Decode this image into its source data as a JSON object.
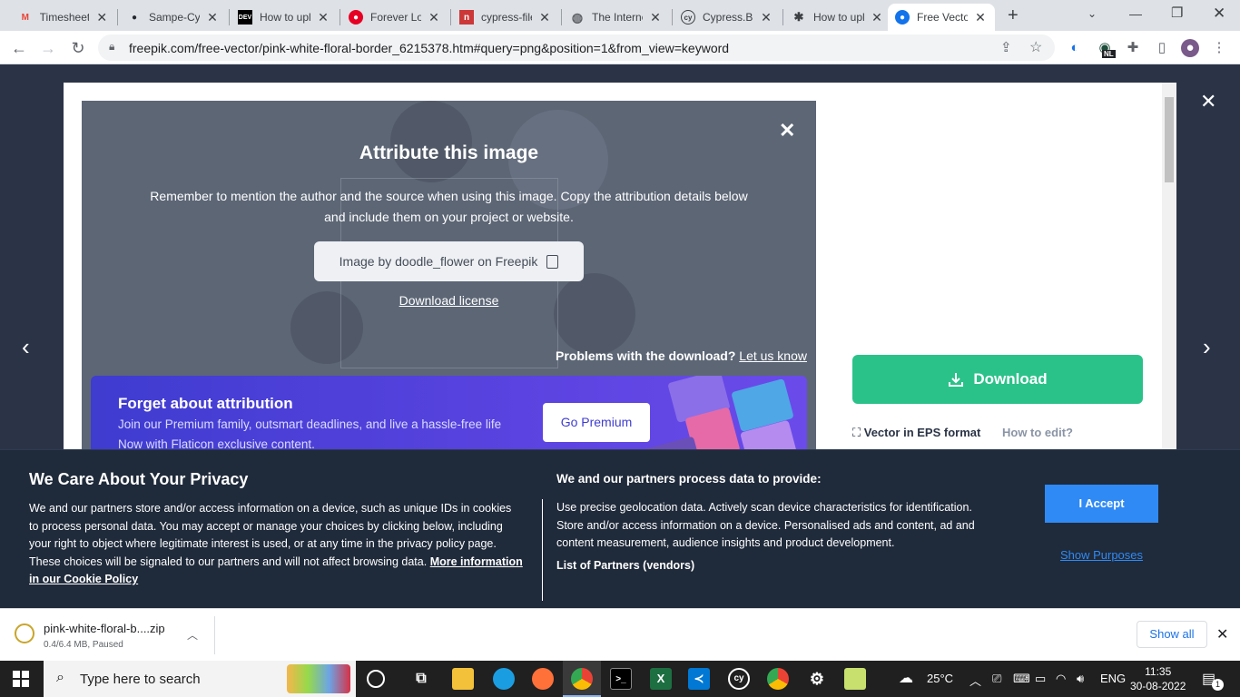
{
  "browser": {
    "tabs": [
      {
        "title": "Timesheet",
        "icon": "gmail-icon",
        "color": "#ea4335"
      },
      {
        "title": "Sampe-Cypress",
        "icon": "github-icon",
        "color": "#24292f"
      },
      {
        "title": "How to upload",
        "icon": "dev-icon",
        "color": "#000000"
      },
      {
        "title": "Forever Love",
        "icon": "pinterest-icon",
        "color": "#e60023"
      },
      {
        "title": "cypress-file",
        "icon": "npm-icon",
        "color": "#cb3837"
      },
      {
        "title": "The Internet",
        "icon": "globe-icon",
        "color": "#5f6368"
      },
      {
        "title": "Cypress.Blog",
        "icon": "cypress-icon",
        "color": "#3c4043"
      },
      {
        "title": "How to upload",
        "icon": "bug-icon",
        "color": "#3c4043"
      },
      {
        "title": "Free Vector",
        "icon": "freepik-icon",
        "color": "#1273eb",
        "active": true
      }
    ],
    "url": "freepik.com/free-vector/pink-white-floral-border_6215378.htm#query=png&position=1&from_view=keyword",
    "new_tab": "+",
    "ext_badge": "NL"
  },
  "modal": {
    "attribution": {
      "title": "Attribute this image",
      "description": "Remember to mention the author and the source when using this image. Copy the attribution details below and include them on your project or website.",
      "credit": "Image by doodle_flower on Freepik",
      "download_license": "Download license",
      "problems": "Problems with the download?",
      "let_us_know": "Let us know"
    },
    "premium": {
      "title": "Forget about attribution",
      "line1": "Join our Premium family, outsmart deadlines, and live a hassle-free life",
      "line2": "Now with Flaticon exclusive content.",
      "button": "Go Premium"
    },
    "download": "Download",
    "format": "Vector in EPS format",
    "how_to_edit": "How to edit?"
  },
  "cookie": {
    "title": "We Care About Your Privacy",
    "text": "We and our partners store and/or access information on a device, such as unique IDs in cookies to process personal data. You may accept or manage your choices by clicking below, including your right to object where legitimate interest is used, or at any time in the privacy policy page. These choices will be signaled to our partners and will not affect browsing data.",
    "more_link": "More information in our Cookie Policy",
    "right_heading": "We and our partners process data to provide:",
    "right_text": "Use precise geolocation data. Actively scan device characteristics for identification. Store and/or access information on a device. Personalised ads and content, ad and content measurement, audience insights and product development.",
    "partners": "List of Partners (vendors)",
    "accept": "I Accept",
    "show_purposes": "Show Purposes"
  },
  "shelf": {
    "filename": "pink-white-floral-b....zip",
    "status": "0.4/6.4 MB, Paused",
    "show_all": "Show all"
  },
  "taskbar": {
    "search_placeholder": "Type here to search",
    "temperature": "25°C",
    "language": "ENG",
    "time": "11:35",
    "date": "30-08-2022",
    "notifications": "1"
  }
}
